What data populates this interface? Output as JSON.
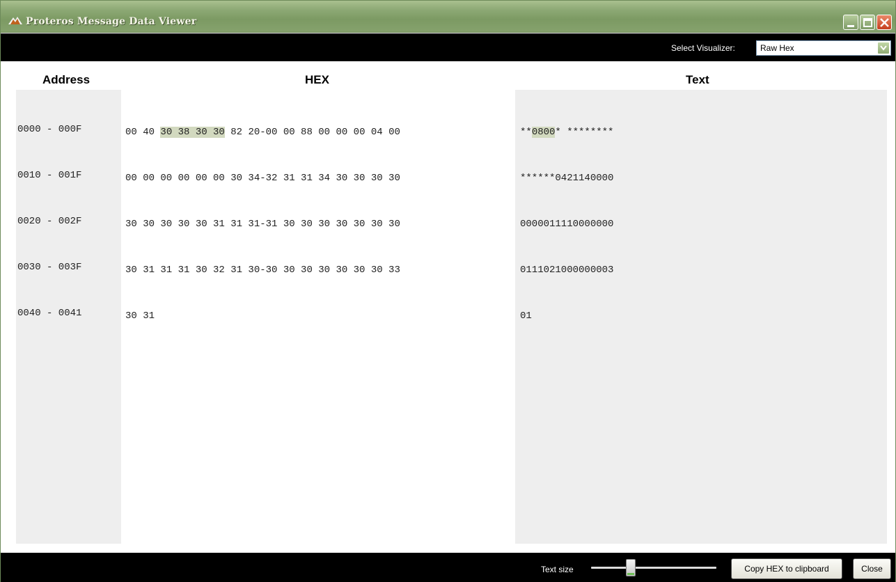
{
  "window": {
    "title": "Proteros Message Data Viewer"
  },
  "toolbar": {
    "visualizer_label": "Select Visualizer:",
    "visualizer_value": "Raw Hex"
  },
  "columns": {
    "address": "Address",
    "hex": "HEX",
    "text": "Text"
  },
  "rows": [
    {
      "address": "0000 - 000F",
      "hex": {
        "before": "00 40 ",
        "highlight": "30 38 30 30",
        "after": " 82 20-00 00 88 00 00 00 04 00"
      },
      "text": {
        "before": "**",
        "highlight": "0800",
        "after": "* ********"
      }
    },
    {
      "address": "0010 - 001F",
      "hex": {
        "before": "00 00 00 00 00 00 30 34-32 31 31 34 30 30 30 30",
        "highlight": "",
        "after": ""
      },
      "text": {
        "before": "******0421140000",
        "highlight": "",
        "after": ""
      }
    },
    {
      "address": "0020 - 002F",
      "hex": {
        "before": "30 30 30 30 30 31 31 31-31 30 30 30 30 30 30 30",
        "highlight": "",
        "after": ""
      },
      "text": {
        "before": "0000011110000000",
        "highlight": "",
        "after": ""
      }
    },
    {
      "address": "0030 - 003F",
      "hex": {
        "before": "30 31 31 31 30 32 31 30-30 30 30 30 30 30 30 33",
        "highlight": "",
        "after": ""
      },
      "text": {
        "before": "0111021000000003",
        "highlight": "",
        "after": ""
      }
    },
    {
      "address": "0040 - 0041",
      "hex": {
        "before": "30 31",
        "highlight": "",
        "after": ""
      },
      "text": {
        "before": "01",
        "highlight": "",
        "after": ""
      }
    }
  ],
  "footer": {
    "text_size_label": "Text size",
    "text_size_value": 0.3,
    "copy_button": "Copy HEX to clipboard",
    "close_button": "Close"
  },
  "colors": {
    "highlight": "#d2d9bf",
    "titlebar": "#8ca874",
    "bar_background": "#000000"
  },
  "icons": [
    "app-logo-icon",
    "minimize-icon",
    "maximize-icon",
    "close-icon",
    "dropdown-arrow-icon"
  ]
}
